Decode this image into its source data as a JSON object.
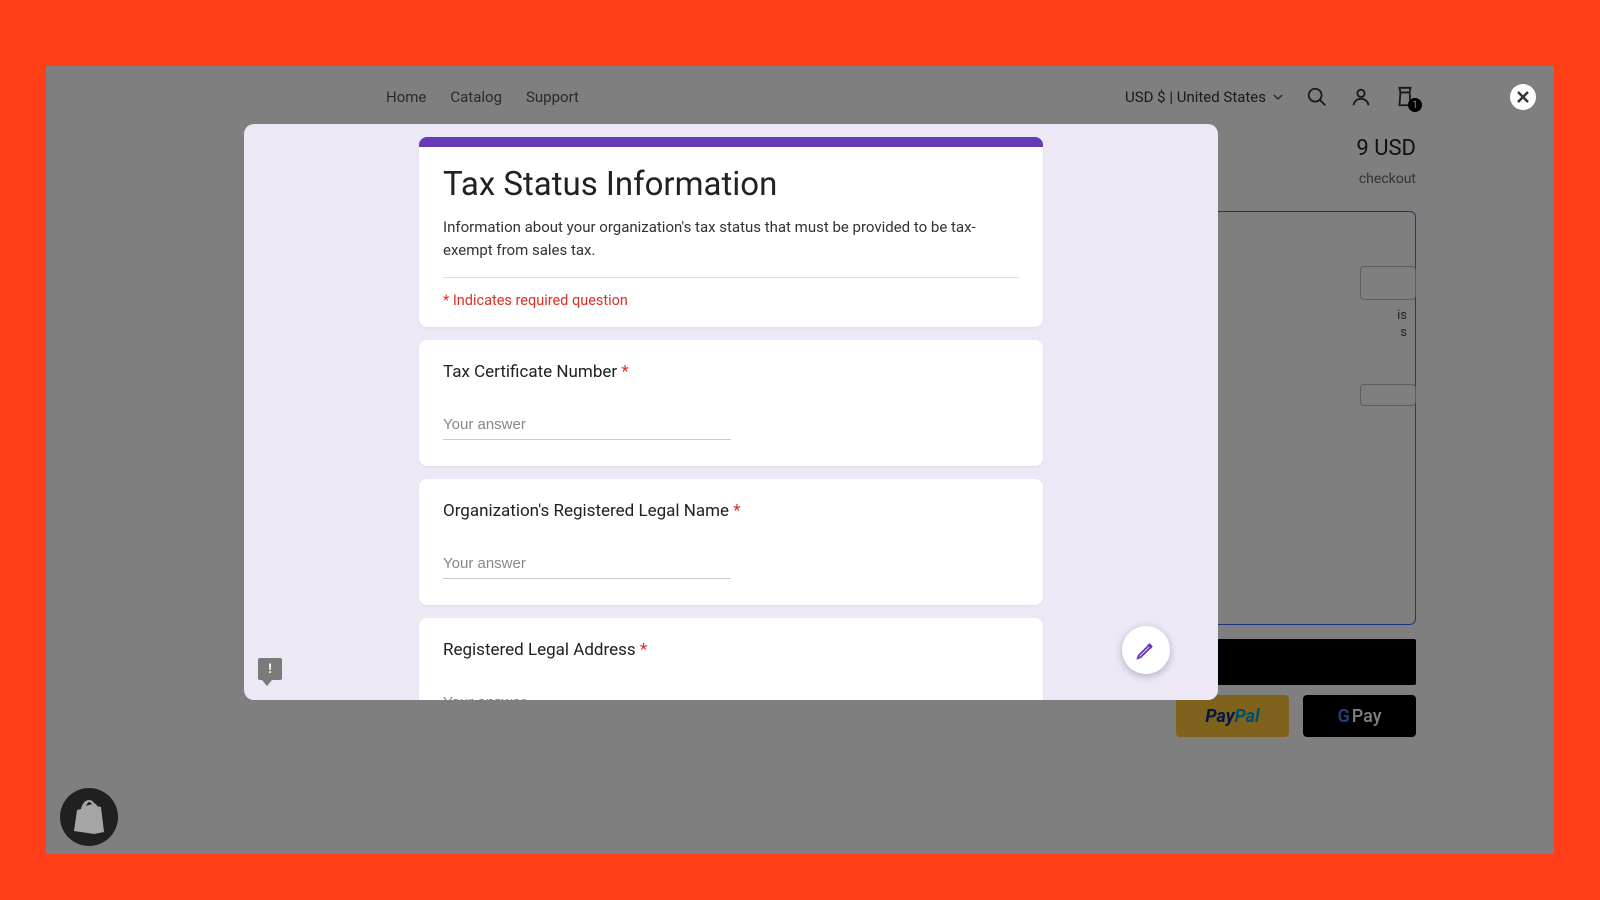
{
  "nav": {
    "home": "Home",
    "catalog": "Catalog",
    "support": "Support"
  },
  "header": {
    "currency": "USD $ | United States",
    "cart_count": "1"
  },
  "product": {
    "price_fragment": "9 USD",
    "checkout_note": "checkout",
    "side_text": "is\ns"
  },
  "buttons": {
    "paypal_a": "Pay",
    "paypal_b": "Pal",
    "gpay_g": "G",
    "gpay_pay": " Pay"
  },
  "form": {
    "title": "Tax Status Information",
    "description": "Information about your organization's tax status that must be provided to be tax-exempt from sales tax.",
    "required_note": "* Indicates required question",
    "placeholder": "Your answer",
    "questions": [
      {
        "label": "Tax Certificate Number",
        "required": true
      },
      {
        "label": "Organization's Registered Legal Name",
        "required": true
      },
      {
        "label": "Registered Legal Address",
        "required": true
      }
    ]
  }
}
